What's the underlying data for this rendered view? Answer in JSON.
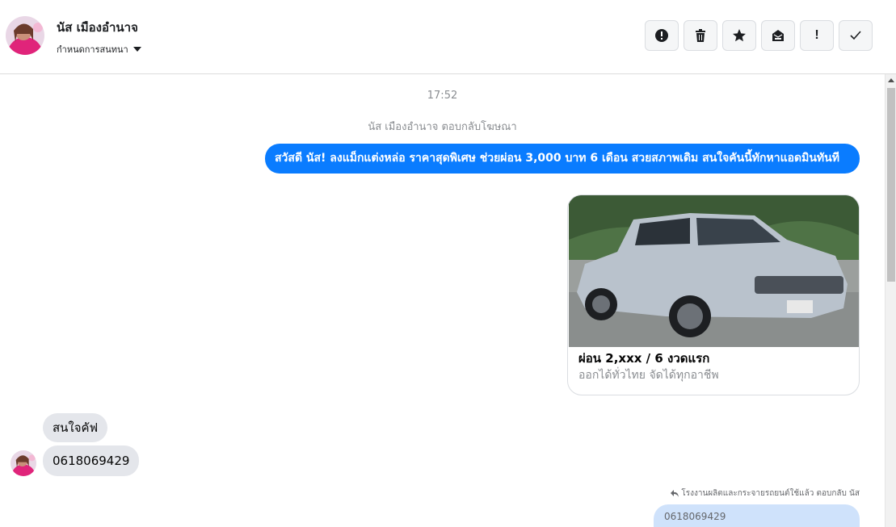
{
  "header": {
    "contact_name": "นัส เมืองอำนาจ",
    "assign_label": "กำหนดการสนทนา",
    "avatar_icon": "contact-avatar",
    "actions": [
      {
        "name": "report-spam-button",
        "icon": "alert-circle-icon"
      },
      {
        "name": "delete-button",
        "icon": "trash-icon"
      },
      {
        "name": "star-button",
        "icon": "star-icon"
      },
      {
        "name": "archive-button",
        "icon": "mail-archive-icon"
      },
      {
        "name": "mark-important-button",
        "icon": "exclamation-icon",
        "glyph": "!"
      },
      {
        "name": "mark-done-button",
        "icon": "check-icon"
      }
    ]
  },
  "conversation": {
    "timestamp": "17:52",
    "reply_note": "นัส เมืองอำนาจ ตอบกลับโฆษณา",
    "outgoing_message": "สวัสดี นัส! ลงแม็กแต่งหล่อ ราคาสุดพิเศษ ช่วยผ่อน 3,000 บาท 6 เดือน สวยสภาพเดิม สนใจคันนี้ทักหาแอดมินทันที",
    "ad_card": {
      "title": "ผ่อน 2,xxx / 6 งวดแรก",
      "subtitle": "ออกได้ทั่วไทย จัดได้ทุกอาชีพ"
    },
    "incoming_messages": [
      "สนใจคัฟ",
      "0618069429"
    ],
    "page_reply_note": "โรงงานผลิตและกระจายรถยนต์ใช้แล้ว ตอบกลับ นัส",
    "page_reply_quote": "0618069429"
  },
  "colors": {
    "outgoing_bubble": "#0a7cff",
    "incoming_bubble": "#e4e6eb",
    "page_bubble": "#cfe2fb"
  }
}
